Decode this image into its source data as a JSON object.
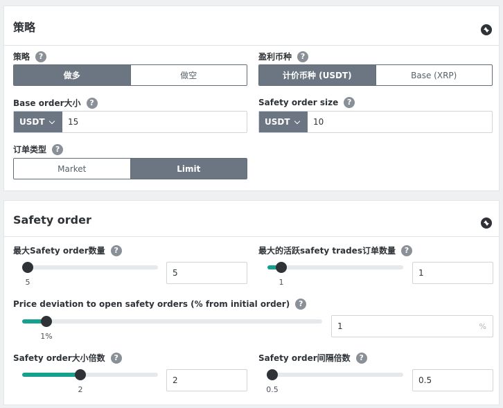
{
  "strategy_card": {
    "title": "策略",
    "strategy": {
      "label": "策略",
      "options": [
        "做多",
        "做空"
      ],
      "selected": 0
    },
    "profit_currency": {
      "label": "盈利币种",
      "options": [
        "计价币种 (USDT)",
        "Base (XRP)"
      ],
      "selected": 0
    },
    "base_order_size": {
      "label": "Base order大小",
      "currency": "USDT",
      "value": "15"
    },
    "safety_order_size": {
      "label": "Safety order size",
      "currency": "USDT",
      "value": "10"
    },
    "order_type": {
      "label": "订单类型",
      "options": [
        "Market",
        "Limit"
      ],
      "selected": 1
    }
  },
  "safety_card": {
    "title": "Safety order",
    "max_safety_orders": {
      "label": "最大Safety order数量",
      "value": "5",
      "display": "5",
      "fraction": 0.04
    },
    "max_active_trades": {
      "label": "最大的活跃safety trades订单数量",
      "value": "1",
      "display": "1",
      "fraction": 0.1
    },
    "price_deviation": {
      "label": "Price deviation to open safety orders (% from initial order)",
      "value": "1",
      "display": "1%",
      "unit": "%",
      "fraction": 0.08
    },
    "size_multiplier": {
      "label": "Safety order大小倍数",
      "value": "2",
      "display": "2",
      "fraction": 0.43
    },
    "step_multiplier": {
      "label": "Safety order间隔倍数",
      "value": "0.5",
      "display": "0.5",
      "fraction": 0.0
    }
  },
  "help_glyph": "?",
  "colors": {
    "accent": "#18a08f",
    "active_segment": "#6b7682",
    "thumb": "#2f3337"
  }
}
